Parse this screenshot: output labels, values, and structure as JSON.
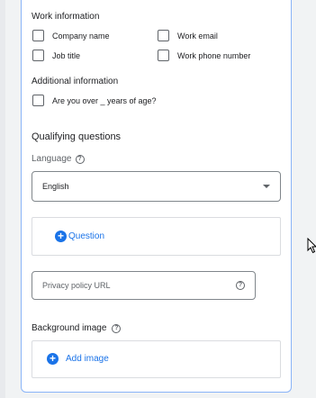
{
  "work_info": {
    "heading": "Work information",
    "options": [
      "Company name",
      "Work email",
      "Job title",
      "Work phone number"
    ]
  },
  "additional_info": {
    "heading": "Additional information",
    "options": [
      "Are you over _ years of age?"
    ]
  },
  "qualifying": {
    "heading": "Qualifying questions",
    "language_label": "Language",
    "language_value": "English",
    "add_question_label": "Question"
  },
  "privacy": {
    "placeholder": "Privacy policy URL"
  },
  "background": {
    "heading": "Background image",
    "add_image_label": "Add image"
  },
  "icons": {
    "help": "help-circle-icon",
    "dropdown": "caret-down-icon",
    "add": "add-circle-icon",
    "cursor": "mouse-pointer-icon"
  },
  "colors": {
    "accent": "#1a73e8",
    "panel_border": "#8ab4f8"
  }
}
